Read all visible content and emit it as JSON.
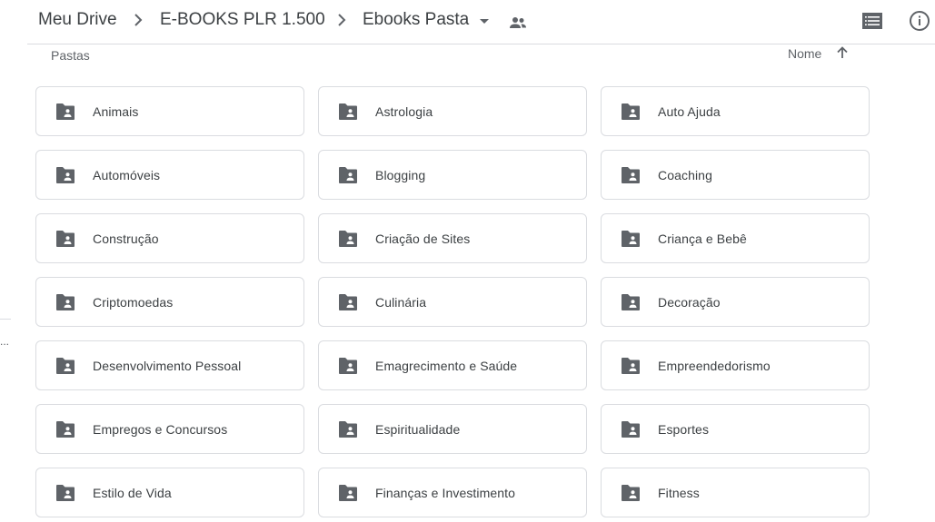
{
  "header": {
    "breadcrumbs": [
      "Meu Drive",
      "E-BOOKS PLR 1.500",
      "Ebooks Pasta"
    ],
    "icons": {
      "separator": "chevron-right-icon",
      "dropdown": "arrow-drop-down-icon",
      "shared": "people-icon",
      "view_toggle": "list-view-icon",
      "details": "info-icon"
    }
  },
  "section": {
    "label": "Pastas",
    "sort_label": "Nome",
    "sort_direction": "ascending"
  },
  "folders": [
    {
      "name": "Animais"
    },
    {
      "name": "Astrologia"
    },
    {
      "name": "Auto Ajuda"
    },
    {
      "name": "Automóveis"
    },
    {
      "name": "Blogging"
    },
    {
      "name": "Coaching"
    },
    {
      "name": "Construção"
    },
    {
      "name": "Criação de Sites"
    },
    {
      "name": "Criança e Bebê"
    },
    {
      "name": "Criptomoedas"
    },
    {
      "name": "Culinária"
    },
    {
      "name": "Decoração"
    },
    {
      "name": "Desenvolvimento Pessoal"
    },
    {
      "name": "Emagrecimento e Saúde"
    },
    {
      "name": "Empreendedorismo"
    },
    {
      "name": "Empregos e Concursos"
    },
    {
      "name": "Espiritualidade"
    },
    {
      "name": "Esportes"
    },
    {
      "name": "Estilo de Vida"
    },
    {
      "name": "Finanças e Investimento"
    },
    {
      "name": "Fitness"
    }
  ],
  "left_edge": {
    "text": "..."
  },
  "colors": {
    "folder_icon": "#5f6368",
    "card_border": "#dadce0",
    "text": "#3c4043",
    "muted": "#5f6368"
  }
}
